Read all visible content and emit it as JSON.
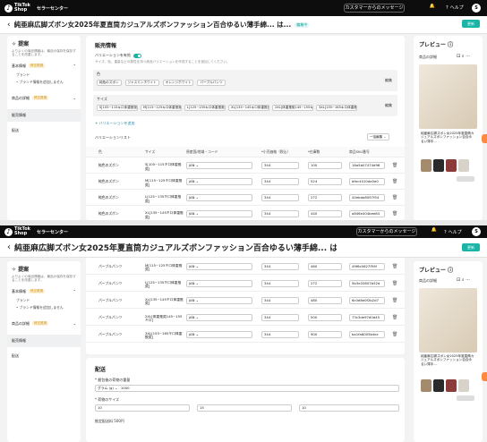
{
  "header": {
    "logo_line1": "TikTok",
    "logo_line2": "Shop",
    "site_name": "セラーセンター",
    "message_button": "カスタマーからのメッセージ",
    "bell_icon": "bell-icon",
    "help_label": "ヘルプ",
    "avatar": "S"
  },
  "page": {
    "back": "‹",
    "title": "純亜麻広脚ズボン女2025年夏直筒カジュアルズボンファッション百合ゆるい薄手綿... は...",
    "draft_badge": "編集中",
    "update_button": "更新"
  },
  "sidebar": {
    "heading": "提案",
    "description": "よりよくの商品情報は、最品の保存を保存することを改善します。",
    "items": [
      {
        "label": "基本情報",
        "tag": "修正推奨"
      },
      {
        "label": "ブランド",
        "sub": true
      },
      {
        "label": "• ブランド情報を追加しません",
        "sub": true
      },
      {
        "label": "商品の詳細",
        "tag": "修正推奨"
      },
      {
        "label": "販売情報"
      },
      {
        "label": "配送"
      }
    ]
  },
  "sales": {
    "heading": "販売情報",
    "variation_toggle": "バリエーションを有効",
    "variation_desc": "サイズ、色、重量などの属性を持つ商品バリエーションを作成することを追加してください。",
    "color_label": "色",
    "colors": [
      "純色のズボン",
      "ジャスミンホワイト",
      "オレンジホワイト",
      "パープルパンツ"
    ],
    "size_label": "サイズ",
    "sizes": [
      "S[105~115キロ体重推奨]",
      "M[115~125キロ体重推奨]",
      "L[125~135キロ体重推奨]",
      "XL[135~145キロ体重推奨]",
      "2XL[体重推奨145~155キロ]",
      "3XL[155~165キロ体重推奨]"
    ],
    "edit": "編集",
    "add_variation": "+ バリエーションを追加",
    "list_label": "バリエーションリスト",
    "bulk_edit": "一括編集",
    "columns": [
      "色",
      "サイズ",
      "原産国/地域・コード",
      "*小売価格（税込）",
      "*在庫数",
      "商品SKU番号"
    ],
    "rows_top": [
      {
        "color": "純色のズボン",
        "size": "S[105~115キロ体重推奨]",
        "origin": "JAN",
        "price": "344",
        "stock": "100",
        "sku": "16a5b07474d96"
      },
      {
        "color": "純色のズボン",
        "size": "M[115~125キロ体重推奨]",
        "origin": "JAN",
        "price": "344",
        "stock": "524",
        "sku": "bfec4010da5e0"
      },
      {
        "color": "純色のズボン",
        "size": "L[125~135キロ体重推奨]",
        "origin": "JAN",
        "price": "344",
        "stock": "272",
        "sku": "44ebda8097f54"
      },
      {
        "color": "純色のズボン",
        "size": "XL[135~145キロ体重推奨]",
        "origin": "JAN",
        "price": "344",
        "stock": "440",
        "sku": "a846e404bee84"
      }
    ],
    "rows_bottom": [
      {
        "color": "パープルパンツ",
        "size": "M[115~125キロ体重推奨]",
        "origin": "JAN",
        "price": "344",
        "stock": "460",
        "sku": "49f6c0627f59f"
      },
      {
        "color": "パープルパンツ",
        "size": "L[125~135キロ体重推奨]",
        "origin": "JAN",
        "price": "344",
        "stock": "272",
        "sku": "5b3e20807b52d"
      },
      {
        "color": "パープルパンツ",
        "size": "XL[135~145キロ体重推奨]",
        "origin": "JAN",
        "price": "344",
        "stock": "480",
        "sku": "6c0d8e0f2b2d7"
      },
      {
        "color": "パープルパンツ",
        "size": "2XL[体重推奨145~155キロ]",
        "origin": "JAN",
        "price": "344",
        "stock": "500",
        "sku": "73c3de97d0d45"
      },
      {
        "color": "パープルパンツ",
        "size": "3XL[155~165キロ体重推奨]",
        "origin": "JAN",
        "price": "344",
        "stock": "900",
        "sku": "ba1fa6005b4ec"
      }
    ],
    "trash_icon": "trash-icon"
  },
  "shipping": {
    "heading": "配送",
    "weight_label": "* 梱包後の荷物の重量",
    "weight_unit": "グラム (g)",
    "weight_value": "1000",
    "size_label": "* 荷物のサイズ",
    "dims": [
      "10",
      "15",
      "10"
    ],
    "dim_unit": "cm",
    "fee_label": "推定配送料 500円"
  },
  "preview": {
    "heading": "プレビュー",
    "tab": "商品の詳細",
    "caption": "純亜麻広脚ズボン女2025年夏直筒カジュアルズボンファッション百合ゆるい薄手..."
  }
}
